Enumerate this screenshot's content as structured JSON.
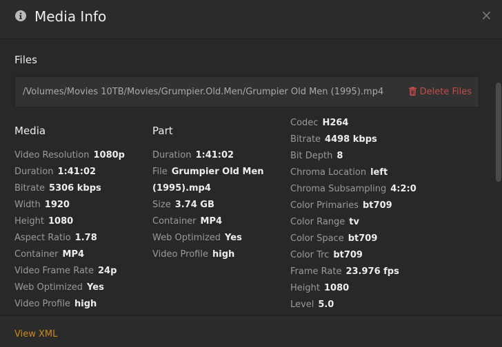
{
  "header": {
    "title": "Media Info",
    "info_icon": "info-circle-icon",
    "close_label": "×"
  },
  "files": {
    "heading": "Files",
    "path": "/Volumes/Movies 10TB/Movies/Grumpier.Old.Men/Grumpier Old Men (1995).mp4",
    "delete_label": "Delete Files",
    "delete_icon": "trash-icon"
  },
  "media": {
    "heading": "Media",
    "rows": [
      {
        "label": "Video Resolution",
        "value": "1080p"
      },
      {
        "label": "Duration",
        "value": "1:41:02"
      },
      {
        "label": "Bitrate",
        "value": "5306 kbps"
      },
      {
        "label": "Width",
        "value": "1920"
      },
      {
        "label": "Height",
        "value": "1080"
      },
      {
        "label": "Aspect Ratio",
        "value": "1.78"
      },
      {
        "label": "Container",
        "value": "MP4"
      },
      {
        "label": "Video Frame Rate",
        "value": "24p"
      },
      {
        "label": "Web Optimized",
        "value": "Yes"
      },
      {
        "label": "Video Profile",
        "value": "high"
      }
    ]
  },
  "part": {
    "heading": "Part",
    "rows": [
      {
        "label": "Duration",
        "value": "1:41:02"
      },
      {
        "label": "File",
        "value": "Grumpier Old Men"
      },
      {
        "label": "",
        "value": "(1995).mp4"
      },
      {
        "label": "Size",
        "value": "3.74 GB"
      },
      {
        "label": "Container",
        "value": "MP4"
      },
      {
        "label": "Web Optimized",
        "value": "Yes"
      },
      {
        "label": "Video Profile",
        "value": "high"
      }
    ]
  },
  "stream": {
    "rows": [
      {
        "label": "Codec",
        "value": "H264"
      },
      {
        "label": "Bitrate",
        "value": "4498 kbps"
      },
      {
        "label": "Bit Depth",
        "value": "8"
      },
      {
        "label": "Chroma Location",
        "value": "left"
      },
      {
        "label": "Chroma Subsampling",
        "value": "4:2:0"
      },
      {
        "label": "Color Primaries",
        "value": "bt709"
      },
      {
        "label": "Color Range",
        "value": "tv"
      },
      {
        "label": "Color Space",
        "value": "bt709"
      },
      {
        "label": "Color Trc",
        "value": "bt709"
      },
      {
        "label": "Frame Rate",
        "value": "23.976 fps"
      },
      {
        "label": "Height",
        "value": "1080"
      },
      {
        "label": "Level",
        "value": "5.0"
      }
    ]
  },
  "footer": {
    "view_xml_label": "View XML"
  },
  "colors": {
    "background": "#282828",
    "accent_orange": "#cc8a1e",
    "delete_red": "#c44c4c"
  }
}
